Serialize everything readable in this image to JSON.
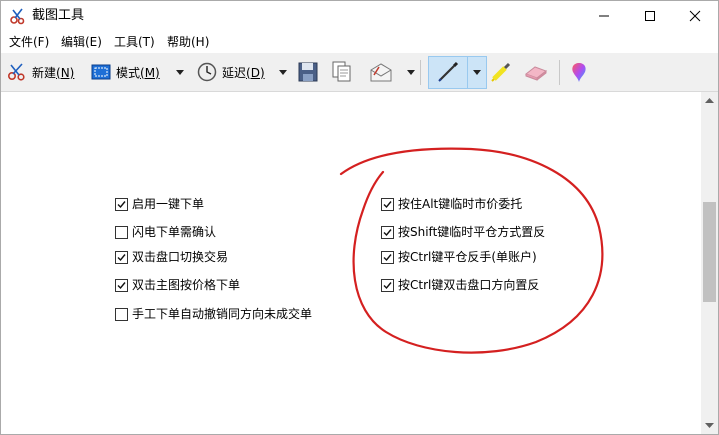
{
  "window": {
    "title": "截图工具"
  },
  "menu": [
    "文件(F)",
    "编辑(E)",
    "工具(T)",
    "帮助(H)"
  ],
  "toolbar": {
    "new_label": "新建",
    "new_key": "(N)",
    "mode_label": "模式",
    "mode_key": "(M)",
    "delay_label": "延迟",
    "delay_key": "(D)"
  },
  "left_options": [
    {
      "label": "启用一键下单",
      "checked": true
    },
    {
      "label": "闪电下单需确认",
      "checked": false
    },
    {
      "label": "双击盘口切换交易",
      "checked": true
    },
    {
      "label": "双击主图按价格下单",
      "checked": true
    },
    {
      "label": "手工下单自动撤销同方向未成交单",
      "checked": false
    }
  ],
  "right_options": [
    {
      "label": "按住Alt键临时市价委托",
      "checked": true
    },
    {
      "label": "按Shift键临时平仓方式置反",
      "checked": true
    },
    {
      "label": "按Ctrl键平仓反手(单账户)",
      "checked": true
    },
    {
      "label": "按Ctrl键双击盘口方向置反",
      "checked": true
    }
  ],
  "colors": {
    "annotation": "#d42020",
    "pen_selected": "#cce4f7"
  }
}
